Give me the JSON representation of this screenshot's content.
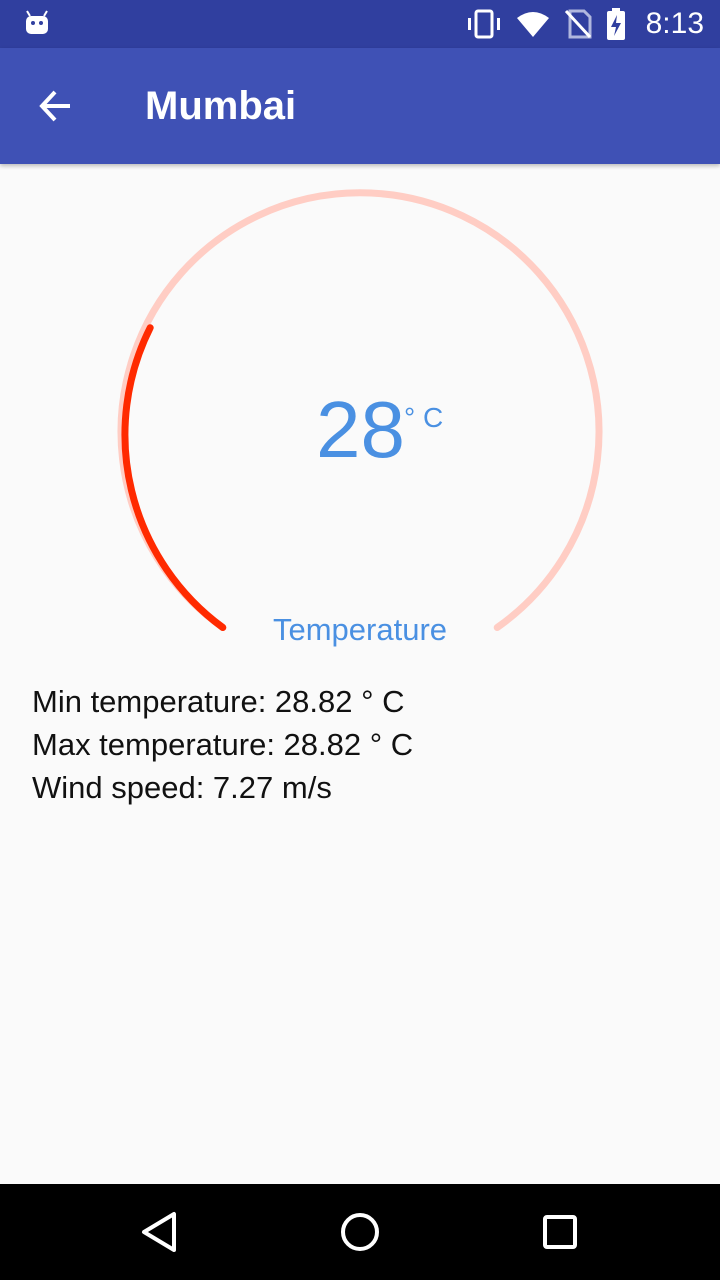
{
  "status_bar": {
    "time": "8:13",
    "icons": [
      "android-icon",
      "vibrate-icon",
      "wifi-icon",
      "no-sim-icon",
      "battery-charging-icon"
    ]
  },
  "app_bar": {
    "back_icon": "arrow-left-icon",
    "title": "Mumbai"
  },
  "gauge": {
    "value": "28",
    "unit": "° C",
    "label": "Temperature",
    "track_color": "#ffcdc4",
    "progress_color": "#ff2a00",
    "text_color": "#4a90e2"
  },
  "details": {
    "min_temp": "Min temperature: 28.82 ° C",
    "max_temp": "Max temperature: 28.82 ° C",
    "wind_speed": "Wind speed: 7.27 m/s"
  },
  "nav_bar": {
    "icons": [
      "back-triangle-icon",
      "home-circle-icon",
      "recents-square-icon"
    ]
  }
}
